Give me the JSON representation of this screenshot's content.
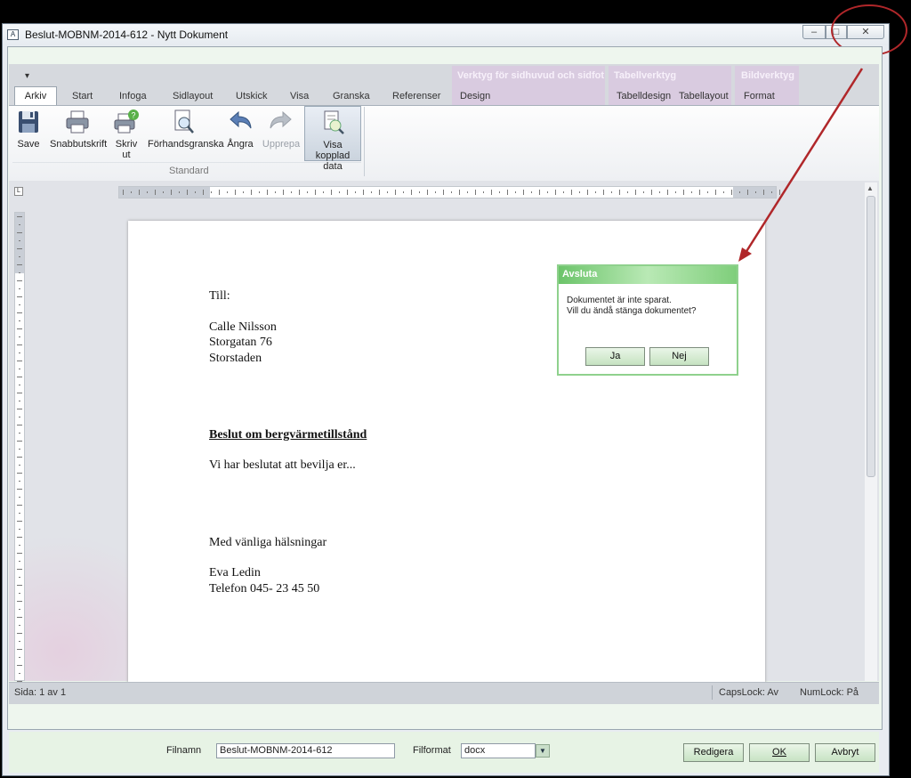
{
  "window": {
    "title": "Beslut-MOBNM-2014-612 - Nytt Dokument"
  },
  "quick_access": {
    "arrow": "▾"
  },
  "ribbon": {
    "contextual": [
      {
        "label": "Verktyg för sidhuvud och sidfot"
      },
      {
        "label": "Tabellverktyg"
      },
      {
        "label": "Bildverktyg"
      }
    ],
    "tabs": [
      "Arkiv",
      "Start",
      "Infoga",
      "Sidlayout",
      "Utskick",
      "Visa",
      "Granska",
      "Referenser",
      "Design",
      "Tabelldesign",
      "Tabellayout",
      "Format"
    ],
    "buttons": {
      "save": "Save",
      "snabbutskrift": "Snabbutskrift",
      "skriv_ut_1": "Skriv",
      "skriv_ut_2": "ut",
      "forhandsgranska": "Förhandsgranska",
      "angra": "Ångra",
      "upprepa": "Upprepa",
      "visa_1": "Visa kopplad",
      "visa_2": "data"
    },
    "group_label": "Standard"
  },
  "document": {
    "till": "Till:",
    "name": "Calle Nilsson",
    "street": "Storgatan 76",
    "city": "Storstaden",
    "heading": "Beslut om bergvärmetillstånd",
    "body": "Vi har beslutat att bevilja er...",
    "greeting": "Med vänliga hälsningar",
    "sender": "Eva Ledin",
    "phone": "Telefon 045- 23 45 50"
  },
  "dialog": {
    "title": "Avsluta",
    "line1": "Dokumentet är inte sparat.",
    "line2": "Vill du ändå stänga dokumentet?",
    "yes": "Ja",
    "no": "Nej"
  },
  "status": {
    "page": "Sida: 1 av 1",
    "capslock": "CapsLock: Av",
    "numlock": "NumLock: På"
  },
  "footer": {
    "filename_label": "Filnamn",
    "filename_value": "Beslut-MOBNM-2014-612",
    "format_label": "Filformat",
    "format_value": "docx",
    "redigera": "Redigera",
    "ok": "OK",
    "avbryt": "Avbryt"
  },
  "colors": {
    "annotation": "#b0272a",
    "dialog_accent": "#6cc46a"
  }
}
